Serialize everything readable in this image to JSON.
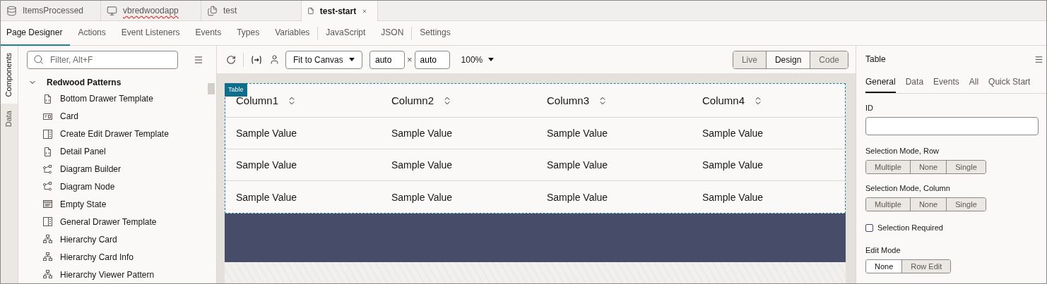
{
  "file_tabs": [
    {
      "label": "ItemsProcessed",
      "kind": "database",
      "selected": false,
      "closable": false,
      "spellcheck": false
    },
    {
      "label": "vbredwoodapp",
      "kind": "monitor",
      "selected": false,
      "closable": false,
      "spellcheck": true
    },
    {
      "label": "test",
      "kind": "pages",
      "selected": false,
      "closable": false,
      "spellcheck": false
    },
    {
      "label": "test-start",
      "kind": "file",
      "selected": true,
      "closable": true,
      "spellcheck": false
    }
  ],
  "designer_tabs": [
    [
      {
        "label": "Page Designer",
        "selected": true
      },
      {
        "label": "Actions",
        "selected": false
      },
      {
        "label": "Event Listeners",
        "selected": false
      },
      {
        "label": "Events",
        "selected": false
      },
      {
        "label": "Types",
        "selected": false
      },
      {
        "label": "Variables",
        "selected": false
      }
    ],
    [
      {
        "label": "JavaScript",
        "selected": false
      },
      {
        "label": "JSON",
        "selected": false
      }
    ],
    [
      {
        "label": "Settings",
        "selected": false
      }
    ]
  ],
  "side_tabs": [
    {
      "label": "Components",
      "selected": true
    },
    {
      "label": "Data",
      "selected": false
    }
  ],
  "components": {
    "placeholder": "Filter, Alt+F",
    "group": {
      "label": "Redwood Patterns",
      "expanded": true
    },
    "items": [
      {
        "label": "Bottom Drawer Template",
        "kind": "template"
      },
      {
        "label": "Card",
        "kind": "card"
      },
      {
        "label": "Create Edit Drawer Template",
        "kind": "drawer"
      },
      {
        "label": "Detail Panel",
        "kind": "template"
      },
      {
        "label": "Diagram Builder",
        "kind": "diagram"
      },
      {
        "label": "Diagram Node",
        "kind": "diagram"
      },
      {
        "label": "Empty State",
        "kind": "empty"
      },
      {
        "label": "General Drawer Template",
        "kind": "drawer"
      },
      {
        "label": "Hierarchy Card",
        "kind": "hierarchy"
      },
      {
        "label": "Hierarchy Card Info",
        "kind": "hierarchy"
      },
      {
        "label": "Hierarchy Viewer Pattern",
        "kind": "hierarchy"
      }
    ]
  },
  "toolbar": {
    "fit": "Fit to Canvas",
    "width": "auto",
    "times": "×",
    "height": "auto",
    "zoom": "100%",
    "modes": [
      {
        "label": "Live",
        "selected": false
      },
      {
        "label": "Design",
        "selected": true
      },
      {
        "label": "Code",
        "selected": false
      }
    ]
  },
  "canvas": {
    "badge": "Table",
    "columns": [
      "Column1",
      "Column2",
      "Column3",
      "Column4"
    ],
    "rows": [
      [
        "Sample Value",
        "Sample Value",
        "Sample Value",
        "Sample Value"
      ],
      [
        "Sample Value",
        "Sample Value",
        "Sample Value",
        "Sample Value"
      ],
      [
        "Sample Value",
        "Sample Value",
        "Sample Value",
        "Sample Value"
      ]
    ]
  },
  "properties": {
    "title": "Table",
    "tabs": [
      {
        "label": "General",
        "selected": true
      },
      {
        "label": "Data",
        "selected": false
      },
      {
        "label": "Events",
        "selected": false
      },
      {
        "label": "All",
        "selected": false
      },
      {
        "label": "Quick Start",
        "selected": false
      }
    ],
    "id_label": "ID",
    "row_mode": {
      "label": "Selection Mode, Row",
      "options": [
        {
          "label": "Multiple",
          "selected": false
        },
        {
          "label": "None",
          "selected": false
        },
        {
          "label": "Single",
          "selected": false
        }
      ]
    },
    "column_mode": {
      "label": "Selection Mode, Column",
      "options": [
        {
          "label": "Multiple",
          "selected": false
        },
        {
          "label": "None",
          "selected": false
        },
        {
          "label": "Single",
          "selected": false
        }
      ]
    },
    "selection_required": {
      "label": "Selection Required",
      "checked": false
    },
    "edit_mode": {
      "label": "Edit Mode",
      "options": [
        {
          "label": "None",
          "selected": true
        },
        {
          "label": "Row Edit",
          "selected": false
        }
      ]
    }
  }
}
